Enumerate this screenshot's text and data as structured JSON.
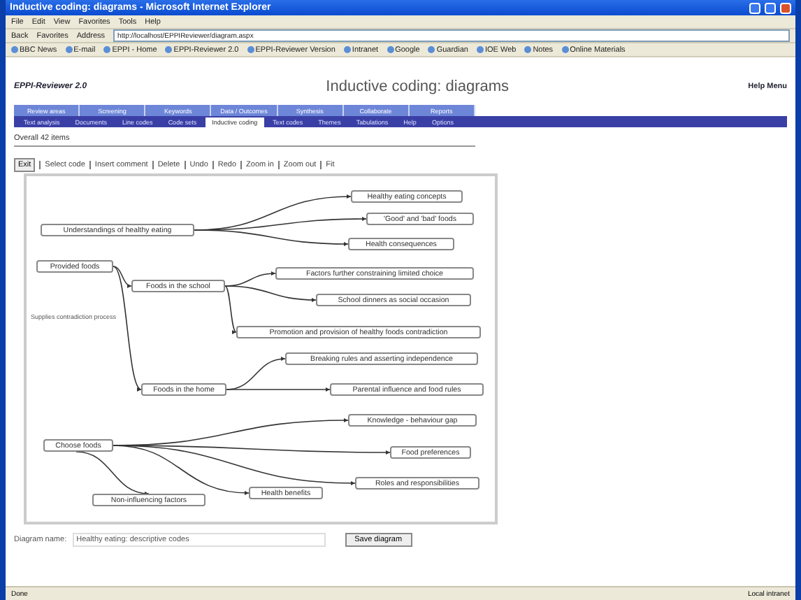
{
  "window": {
    "title": "Inductive coding: diagrams - Microsoft Internet Explorer"
  },
  "menu": [
    "File",
    "Edit",
    "View",
    "Favorites",
    "Tools",
    "Help"
  ],
  "toolbar": {
    "back": "Back",
    "favorites": "Favorites",
    "address_label": "Address",
    "address": "http://localhost/EPPIReviewer/diagram.aspx"
  },
  "links": [
    "BBC News",
    "E-mail",
    "EPPI - Home",
    "EPPI-Reviewer 2.0",
    "EPPI-Reviewer Version",
    "Intranet",
    "Google",
    "Guardian",
    "IOE Web",
    "Notes",
    "Online Materials"
  ],
  "page": {
    "app_name": "EPPI-Reviewer 2.0",
    "heading": "Inductive coding: diagrams",
    "user": "Help Menu"
  },
  "nav_primary": [
    {
      "label": "Review areas",
      "selected": false
    },
    {
      "label": "Screening",
      "selected": false
    },
    {
      "label": "Keywords",
      "selected": false
    },
    {
      "label": "Data / Outcomes",
      "selected": false
    },
    {
      "label": "Synthesis",
      "selected": false
    },
    {
      "label": "Collaborate",
      "selected": false
    },
    {
      "label": "Reports",
      "selected": false
    }
  ],
  "nav_secondary": [
    {
      "label": "Text analysis",
      "selected": false
    },
    {
      "label": "Documents",
      "selected": false
    },
    {
      "label": "Line codes",
      "selected": false
    },
    {
      "label": "Code sets",
      "selected": false
    },
    {
      "label": "Inductive coding",
      "selected": true
    },
    {
      "label": "Text codes",
      "selected": false
    },
    {
      "label": "Themes",
      "selected": false
    },
    {
      "label": "Tabulations",
      "selected": false
    },
    {
      "label": "Help",
      "selected": false
    },
    {
      "label": "Options",
      "selected": false
    }
  ],
  "item_count": "Overall 42 items",
  "diagram_tools": [
    "Exit",
    "Select code",
    "Insert comment",
    "Delete",
    "Undo",
    "Redo",
    "Zoom in",
    "Zoom out",
    "Fit"
  ],
  "diagram": {
    "nodes": [
      {
        "label": "Understandings of healthy eating",
        "children": [
          {
            "label": "Healthy eating concepts"
          },
          {
            "label": "'Good' and 'bad' foods"
          },
          {
            "label": "Health consequences"
          }
        ]
      },
      {
        "label": "Provided foods",
        "children": [
          {
            "label": "Foods in the school",
            "children": [
              {
                "label": "Factors further constraining limited choice"
              },
              {
                "label": "School dinners as social occasion"
              },
              {
                "label": "Promotion and provision of healthy foods contradiction"
              }
            ]
          },
          {
            "label": "Foods in the home",
            "edge_label": "Supplies contradiction process",
            "children": [
              {
                "label": "Breaking rules and asserting independence"
              },
              {
                "label": "Parental influence and food rules"
              }
            ]
          }
        ]
      },
      {
        "label": "Choose foods",
        "children": [
          {
            "label": "Knowledge - behaviour gap"
          },
          {
            "label": "Food preferences"
          },
          {
            "label": "Roles and responsibilities"
          },
          {
            "label": "Health benefits"
          },
          {
            "label": "Non-influencing factors"
          }
        ]
      }
    ]
  },
  "diagram_name": {
    "label": "Diagram name:",
    "value": "Healthy eating: descriptive codes",
    "button": "Save diagram"
  },
  "status_bar": {
    "status": "Done",
    "zone": "Local intranet"
  }
}
